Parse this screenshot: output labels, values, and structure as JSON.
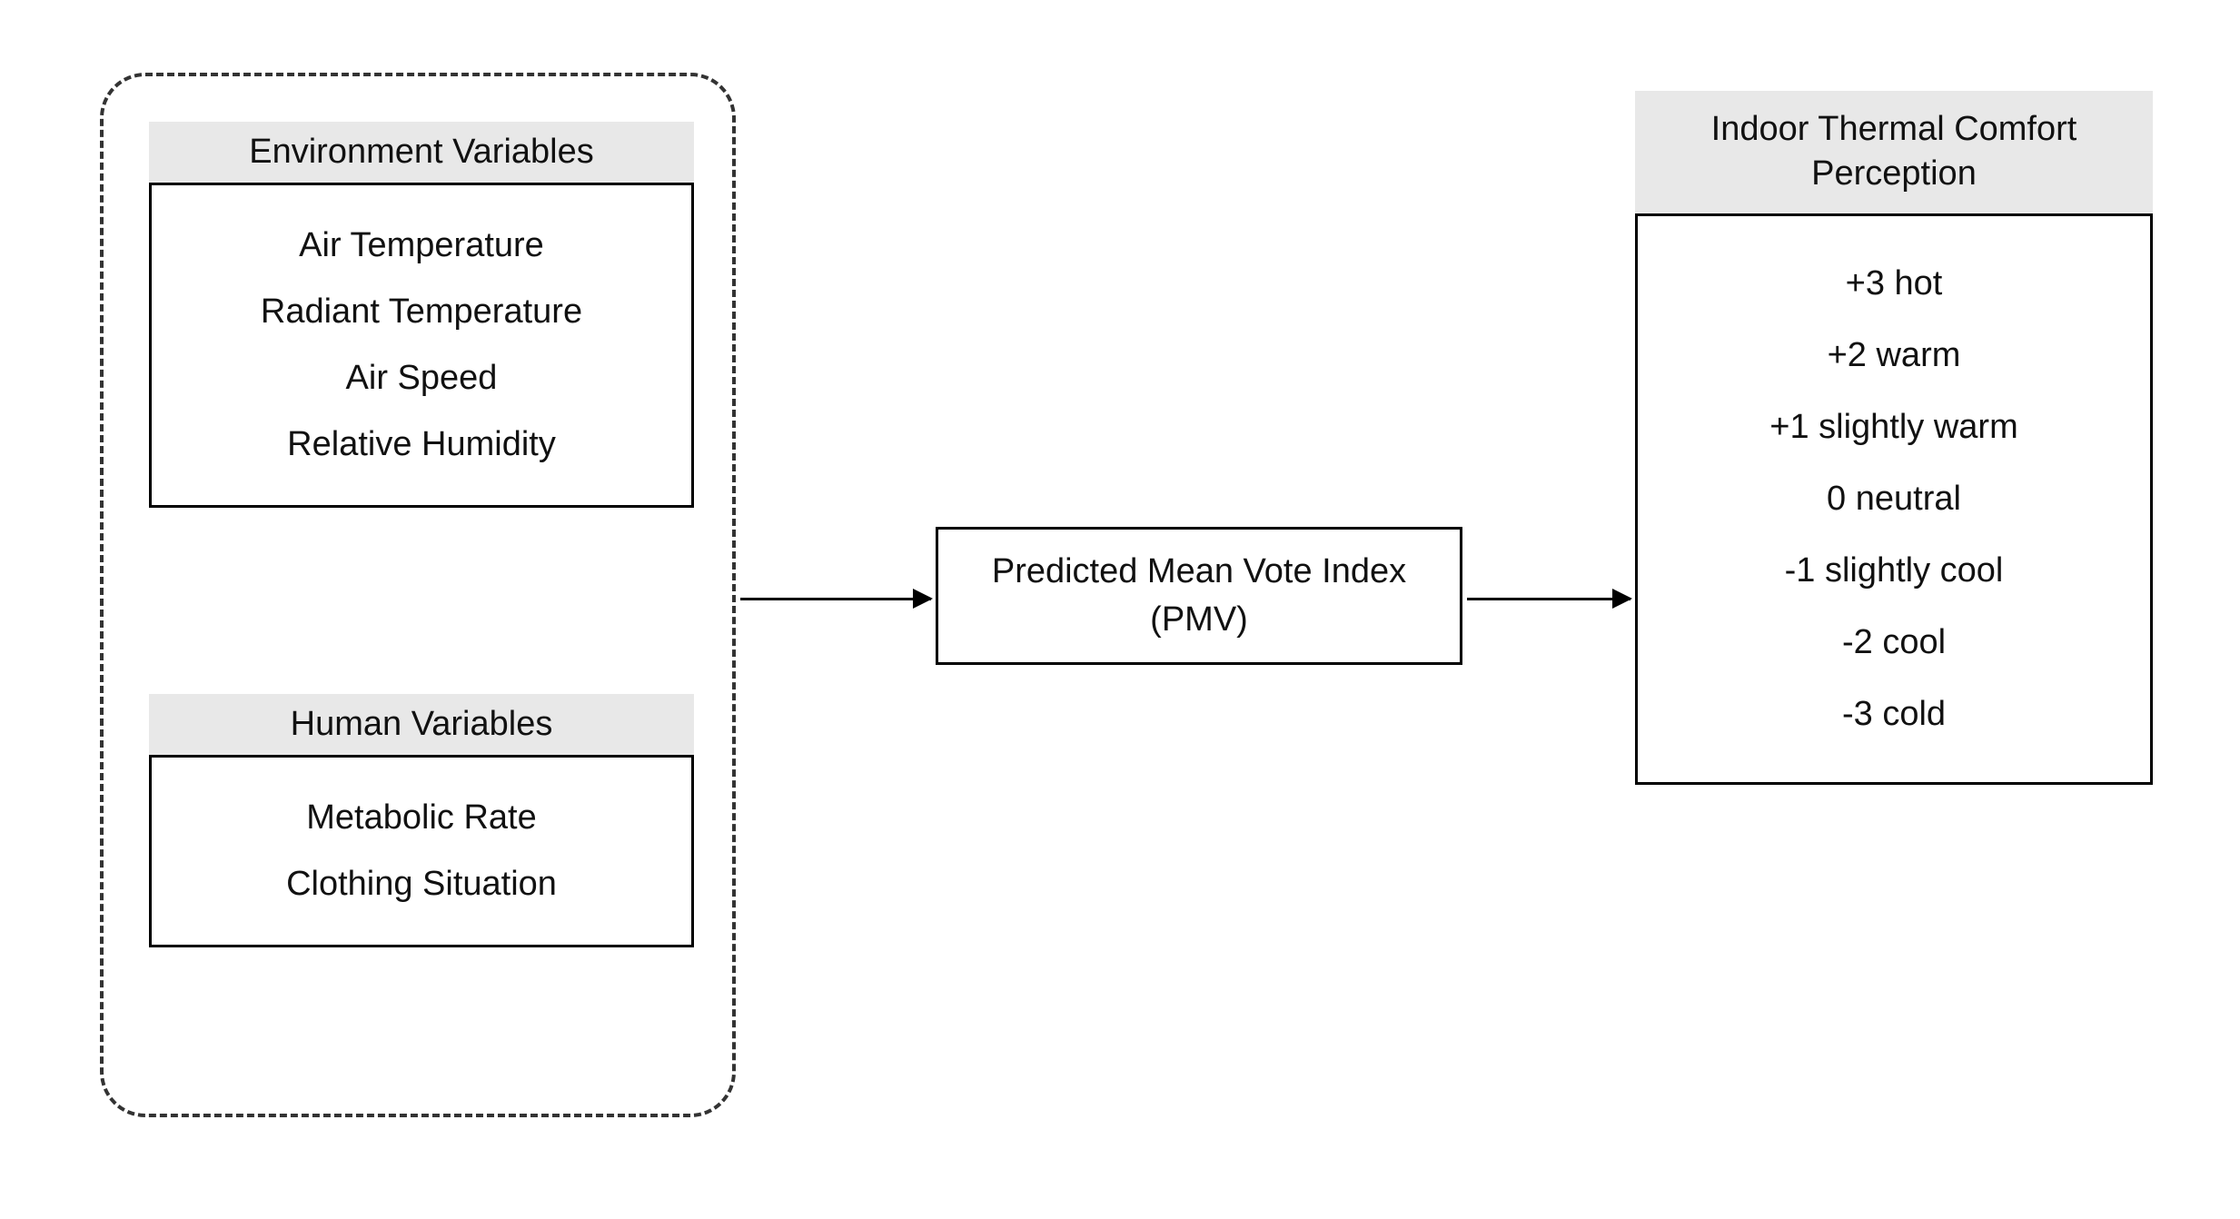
{
  "inputs": {
    "environment": {
      "header": "Environment Variables",
      "items": [
        "Air Temperature",
        "Radiant Temperature",
        "Air Speed",
        "Relative Humidity"
      ]
    },
    "human": {
      "header": "Human Variables",
      "items": [
        "Metabolic Rate",
        "Clothing Situation"
      ]
    }
  },
  "model": {
    "label": "Predicted Mean Vote Index (PMV)"
  },
  "output": {
    "header": "Indoor Thermal Comfort Perception",
    "scale": [
      "+3 hot",
      "+2 warm",
      "+1 slightly warm",
      "0 neutral",
      "-1 slightly cool",
      "-2 cool",
      "-3 cold"
    ]
  }
}
